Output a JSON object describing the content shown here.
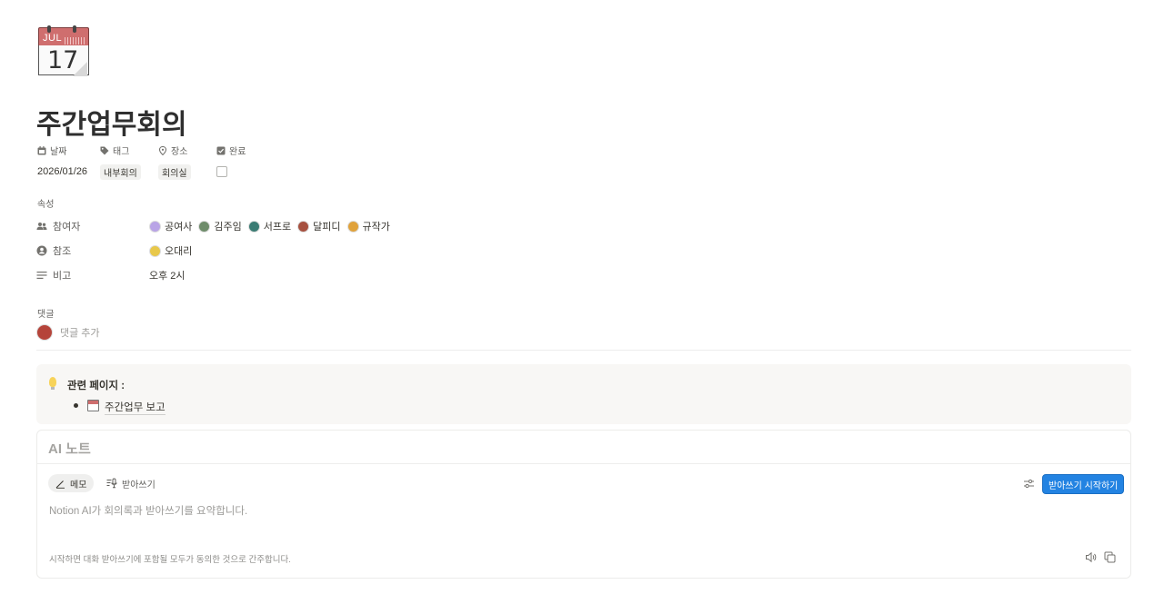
{
  "page_icon": {
    "name": "calendar-icon",
    "month": "JUL",
    "day": "17"
  },
  "title": "주간업무회의",
  "properties_top": [
    {
      "label": "날짜",
      "icon": "calendar-small-icon",
      "value": "2026/01/26"
    },
    {
      "label": "태그",
      "icon": "tag-icon",
      "value": "내부회의"
    },
    {
      "label": "장소",
      "icon": "pin-icon",
      "value": "회의실"
    },
    {
      "label": "완료",
      "icon": "checkbox-icon",
      "checked": false
    }
  ],
  "properties_section_label": "속성",
  "properties": {
    "attendees": {
      "label": "참여자",
      "icon": "people-icon",
      "people": [
        {
          "name": "공여사",
          "color": "#b9a4e6"
        },
        {
          "name": "김주임",
          "color": "#6e8c6a"
        },
        {
          "name": "서프로",
          "color": "#3a7b73"
        },
        {
          "name": "달피디",
          "color": "#a6503f"
        },
        {
          "name": "규작가",
          "color": "#e0a23a"
        }
      ]
    },
    "reference": {
      "label": "참조",
      "icon": "person-circle-icon",
      "people": [
        {
          "name": "오대리",
          "color": "#e8c84a"
        }
      ]
    },
    "notes": {
      "label": "비고",
      "icon": "lines-icon",
      "value": "오후 2시"
    }
  },
  "comments": {
    "label": "댓글",
    "add_placeholder": "댓글 추가",
    "avatar_color": "#b5443a"
  },
  "callout": {
    "icon": "lightbulb-icon",
    "title": "관련 페이지 :",
    "links": [
      {
        "icon": "calendar-mini-icon",
        "text": "주간업무 보고"
      }
    ]
  },
  "ai_note": {
    "title": "AI 노트",
    "tabs": [
      {
        "label": "메모",
        "icon": "pen-icon",
        "active": true
      },
      {
        "label": "받아쓰기",
        "icon": "transcribe-icon",
        "active": false
      }
    ],
    "settings_icon": "sliders-icon",
    "start_button": "받아쓰기 시작하기",
    "description": "Notion AI가 회의록과 받아쓰기를 요약합니다.",
    "footer": "시작하면 대화 받아쓰기에 포함될 모두가 동의한 것으로 간주합니다.",
    "footer_icons": [
      "speaker-icon",
      "copy-icon"
    ],
    "accent_color": "#2383e2"
  }
}
